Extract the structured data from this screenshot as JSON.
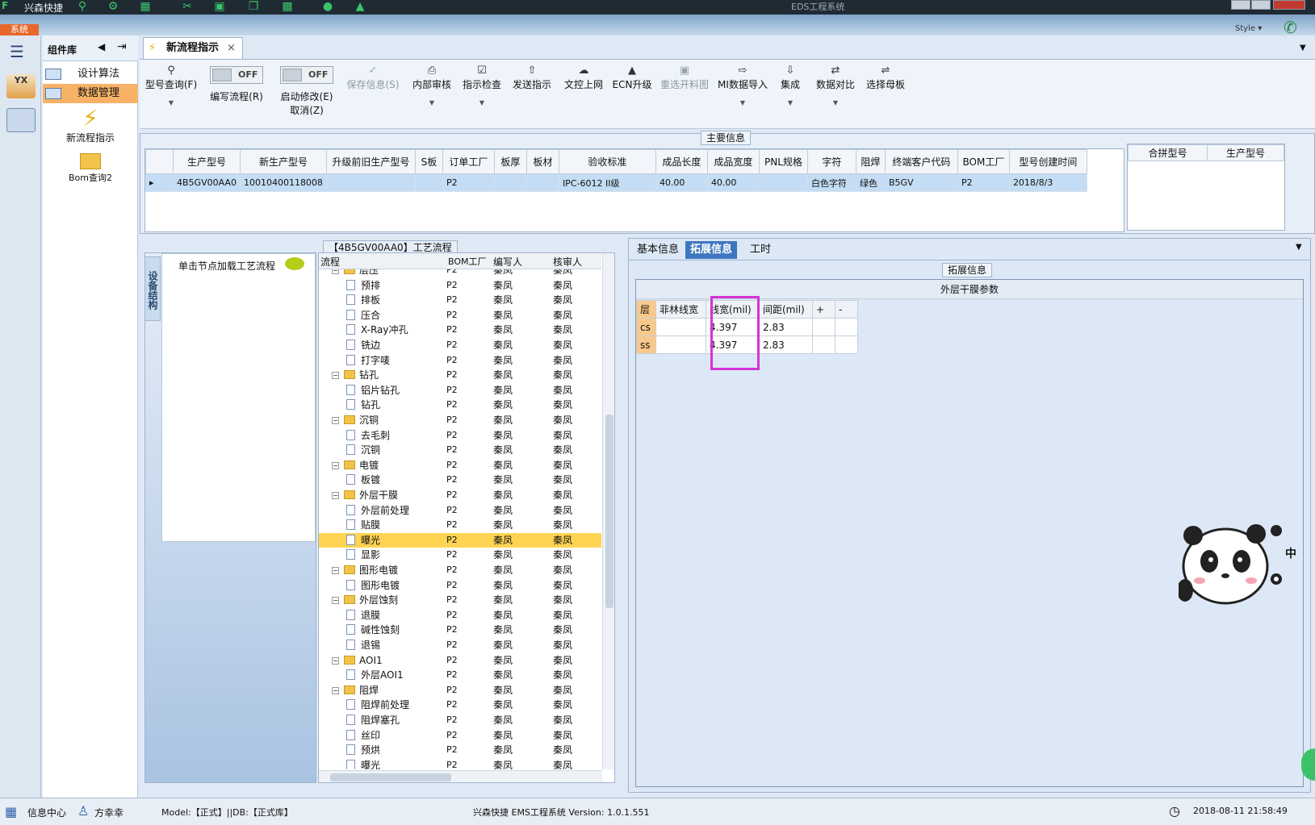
{
  "titlebar": {
    "app_name": "兴森快捷",
    "window_title": "EDS工程系统"
  },
  "ribbon": {
    "system_button": "系统",
    "style_label": "Style"
  },
  "component_library": {
    "title": "组件库",
    "items": [
      {
        "label": "设计算法",
        "selected": false
      },
      {
        "label": "数据管理",
        "selected": true
      }
    ],
    "big_items": [
      {
        "label": "新流程指示",
        "icon": "lightning-icon"
      },
      {
        "label": "Bom查询2",
        "icon": "folder-icon"
      }
    ]
  },
  "doc_tab": {
    "label": "新流程指示"
  },
  "toolbar": {
    "buttons": [
      {
        "label": "型号查询(F)",
        "icon": "search-icon",
        "dropdown": true,
        "disabled": false
      },
      {
        "label": "编写流程(R)",
        "toggle": "OFF"
      },
      {
        "label": "启动修改(E)",
        "label2": "取消(Z)",
        "toggle": "OFF"
      },
      {
        "label": "保存信息(S)",
        "icon": "check-icon",
        "disabled": true
      },
      {
        "label": "内部审核",
        "icon": "printer-icon",
        "dropdown": true,
        "disabled": false
      },
      {
        "label": "指示检查",
        "icon": "checkbox-icon",
        "dropdown": true,
        "disabled": false
      },
      {
        "label": "发送指示",
        "icon": "upload-icon",
        "disabled": false
      },
      {
        "label": "文控上网",
        "icon": "cloud-upload-icon",
        "disabled": false
      },
      {
        "label": "ECN升级",
        "icon": "ecn-icon",
        "disabled": false
      },
      {
        "label": "重选开料图",
        "icon": "image-icon",
        "disabled": true
      },
      {
        "label": "MI数据导入",
        "icon": "import-icon",
        "dropdown": true,
        "disabled": false
      },
      {
        "label": "集成",
        "icon": "download-icon",
        "dropdown": true,
        "disabled": false
      },
      {
        "label": "数据对比",
        "icon": "compare-icon",
        "dropdown": true,
        "disabled": false
      },
      {
        "label": "选择母板",
        "icon": "shuffle-icon",
        "disabled": false
      }
    ]
  },
  "main_info": {
    "section_title": "主要信息",
    "columns": [
      "生产型号",
      "新生产型号",
      "升级前旧生产型号",
      "S板",
      "订单工厂",
      "板厚",
      "板材",
      "验收标准",
      "成品长度",
      "成品宽度",
      "PNL规格",
      "字符",
      "阻焊",
      "终端客户代码",
      "BOM工厂",
      "型号创建时间"
    ],
    "rows": [
      [
        "4B5GV00AA0",
        "10010400118008",
        "",
        "",
        "P2",
        "",
        "",
        "IPC-6012 II级",
        "40.00",
        "40.00",
        "",
        "白色字符",
        "绿色",
        "B5GV",
        "P2",
        "2018/8/3"
      ]
    ],
    "merge_columns": [
      "合拼型号",
      "生产型号"
    ]
  },
  "side_panel": {
    "vertical_tab": "设备结构",
    "node_hint": "单击节点加载工艺流程"
  },
  "process_tree": {
    "title": "【4B5GV00AA0】工艺流程",
    "columns": [
      "流程",
      "BOM工厂",
      "编写人",
      "核审人"
    ],
    "rows": [
      {
        "name": "层压",
        "level": 0,
        "bom": "P2",
        "writer": "秦凤",
        "reviewer": "秦凤"
      },
      {
        "name": "预排",
        "level": 1,
        "bom": "P2",
        "writer": "秦凤",
        "reviewer": "秦凤"
      },
      {
        "name": "排板",
        "level": 1,
        "bom": "P2",
        "writer": "秦凤",
        "reviewer": "秦凤"
      },
      {
        "name": "压合",
        "level": 1,
        "bom": "P2",
        "writer": "秦凤",
        "reviewer": "秦凤"
      },
      {
        "name": "X-Ray冲孔",
        "level": 1,
        "bom": "P2",
        "writer": "秦凤",
        "reviewer": "秦凤"
      },
      {
        "name": "铣边",
        "level": 1,
        "bom": "P2",
        "writer": "秦凤",
        "reviewer": "秦凤"
      },
      {
        "name": "打字唛",
        "level": 1,
        "bom": "P2",
        "writer": "秦凤",
        "reviewer": "秦凤"
      },
      {
        "name": "钻孔",
        "level": 0,
        "bom": "P2",
        "writer": "秦凤",
        "reviewer": "秦凤"
      },
      {
        "name": "铝片钻孔",
        "level": 1,
        "bom": "P2",
        "writer": "秦凤",
        "reviewer": "秦凤"
      },
      {
        "name": "钻孔",
        "level": 1,
        "bom": "P2",
        "writer": "秦凤",
        "reviewer": "秦凤"
      },
      {
        "name": "沉铜",
        "level": 0,
        "bom": "P2",
        "writer": "秦凤",
        "reviewer": "秦凤"
      },
      {
        "name": "去毛刺",
        "level": 1,
        "bom": "P2",
        "writer": "秦凤",
        "reviewer": "秦凤"
      },
      {
        "name": "沉铜",
        "level": 1,
        "bom": "P2",
        "writer": "秦凤",
        "reviewer": "秦凤"
      },
      {
        "name": "电镀",
        "level": 0,
        "bom": "P2",
        "writer": "秦凤",
        "reviewer": "秦凤"
      },
      {
        "name": "板镀",
        "level": 1,
        "bom": "P2",
        "writer": "秦凤",
        "reviewer": "秦凤"
      },
      {
        "name": "外层干膜",
        "level": 0,
        "bom": "P2",
        "writer": "秦凤",
        "reviewer": "秦凤"
      },
      {
        "name": "外层前处理",
        "level": 1,
        "bom": "P2",
        "writer": "秦凤",
        "reviewer": "秦凤"
      },
      {
        "name": "贴膜",
        "level": 1,
        "bom": "P2",
        "writer": "秦凤",
        "reviewer": "秦凤"
      },
      {
        "name": "曝光",
        "level": 1,
        "bom": "P2",
        "writer": "秦凤",
        "reviewer": "秦凤",
        "selected": true
      },
      {
        "name": "显影",
        "level": 1,
        "bom": "P2",
        "writer": "秦凤",
        "reviewer": "秦凤"
      },
      {
        "name": "图形电镀",
        "level": 0,
        "bom": "P2",
        "writer": "秦凤",
        "reviewer": "秦凤"
      },
      {
        "name": "图形电镀",
        "level": 1,
        "bom": "P2",
        "writer": "秦凤",
        "reviewer": "秦凤"
      },
      {
        "name": "外层蚀刻",
        "level": 0,
        "bom": "P2",
        "writer": "秦凤",
        "reviewer": "秦凤"
      },
      {
        "name": "退膜",
        "level": 1,
        "bom": "P2",
        "writer": "秦凤",
        "reviewer": "秦凤"
      },
      {
        "name": "碱性蚀刻",
        "level": 1,
        "bom": "P2",
        "writer": "秦凤",
        "reviewer": "秦凤"
      },
      {
        "name": "退锡",
        "level": 1,
        "bom": "P2",
        "writer": "秦凤",
        "reviewer": "秦凤"
      },
      {
        "name": "AOI1",
        "level": 0,
        "bom": "P2",
        "writer": "秦凤",
        "reviewer": "秦凤"
      },
      {
        "name": "外层AOI1",
        "level": 1,
        "bom": "P2",
        "writer": "秦凤",
        "reviewer": "秦凤"
      },
      {
        "name": "阻焊",
        "level": 0,
        "bom": "P2",
        "writer": "秦凤",
        "reviewer": "秦凤"
      },
      {
        "name": "阻焊前处理",
        "level": 1,
        "bom": "P2",
        "writer": "秦凤",
        "reviewer": "秦凤"
      },
      {
        "name": "阻焊塞孔",
        "level": 1,
        "bom": "P2",
        "writer": "秦凤",
        "reviewer": "秦凤"
      },
      {
        "name": "丝印",
        "level": 1,
        "bom": "P2",
        "writer": "秦凤",
        "reviewer": "秦凤"
      },
      {
        "name": "预烘",
        "level": 1,
        "bom": "P2",
        "writer": "秦凤",
        "reviewer": "秦凤"
      },
      {
        "name": "曝光",
        "level": 1,
        "bom": "P2",
        "writer": "秦凤",
        "reviewer": "秦凤"
      }
    ]
  },
  "right_tabs": {
    "tabs": [
      "基本信息",
      "拓展信息",
      "工时"
    ],
    "active": "拓展信息"
  },
  "extended_info": {
    "section_title": "拓展信息",
    "table_title": "外层干膜参数",
    "columns": [
      "层",
      "菲林线宽",
      "线宽(mil)",
      "间距(mil)",
      "+",
      "-"
    ],
    "rows": [
      [
        "cs",
        "",
        "4.397",
        "2.83",
        "",
        ""
      ],
      [
        "ss",
        "",
        "4.397",
        "2.83",
        "",
        ""
      ]
    ],
    "highlight_color": "#d633d6"
  },
  "side_badge": {
    "text": "中"
  },
  "statusbar": {
    "info_center": "信息中心",
    "user": "方幸幸",
    "model_db": "Model:【正式】||DB:【正式库】",
    "version": "兴森快捷 EMS工程系统 Version: 1.0.1.551",
    "datetime": "2018-08-11 21:58:49"
  }
}
